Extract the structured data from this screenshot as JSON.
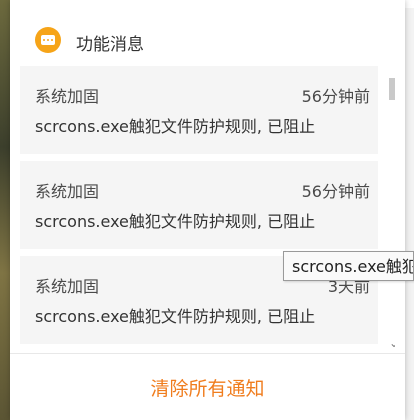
{
  "panel": {
    "title": "功能消息",
    "clear_all_label": "清除所有通知",
    "notifications": [
      {
        "title": "系统加固",
        "time": "56分钟前",
        "message": "scrcons.exe触犯文件防护规则, 已阻止"
      },
      {
        "title": "系统加固",
        "time": "56分钟前",
        "message": "scrcons.exe触犯文件防护规则, 已阻止"
      },
      {
        "title": "系统加固",
        "time": "3天前",
        "message": "scrcons.exe触犯文件防护规则, 已阻止"
      }
    ]
  },
  "tooltip": {
    "text": "scrcons.exe触犯"
  },
  "colors": {
    "accent_orange": "#f07d1e",
    "icon_orange": "#f6a418",
    "card_bg": "#f5f5f5"
  }
}
